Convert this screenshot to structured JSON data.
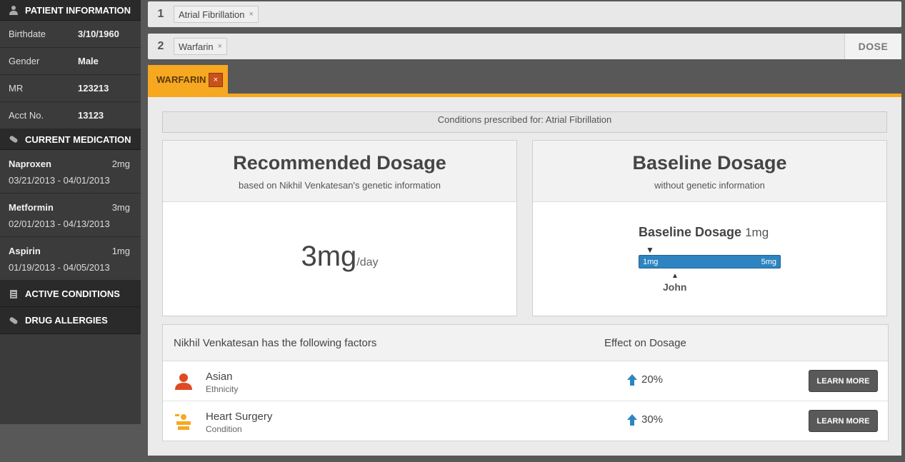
{
  "patient": {
    "header": "PATIENT INFORMATION",
    "fields": [
      {
        "label": "Birthdate",
        "value": "3/10/1960"
      },
      {
        "label": "Gender",
        "value": "Male"
      },
      {
        "label": "MR",
        "value": "123213"
      },
      {
        "label": "Acct No.",
        "value": "13123"
      }
    ]
  },
  "medication": {
    "header": "CURRENT MEDICATION",
    "items": [
      {
        "name": "Naproxen",
        "amount": "2mg",
        "dates": "03/21/2013 - 04/01/2013"
      },
      {
        "name": "Metformin",
        "amount": "3mg",
        "dates": "02/01/2013 - 04/13/2013"
      },
      {
        "name": "Aspirin",
        "amount": "1mg",
        "dates": "01/19/2013 - 04/05/2013"
      }
    ]
  },
  "conditions_header": "ACTIVE CONDITIONS",
  "allergies_header": "DRUG ALLERGIES",
  "query": {
    "row1": {
      "num": "1",
      "chip": "Atrial Fibrillation",
      "chip_close": "×"
    },
    "row2": {
      "num": "2",
      "chip": "Warfarin",
      "chip_close": "×"
    },
    "dose_button": "DOSE"
  },
  "tab": {
    "label": "WARFARIN",
    "close": "×"
  },
  "condition_line": "Conditions prescribed for: Atrial Fibrillation",
  "recommended": {
    "title": "Recommended Dosage",
    "subtitle": "based on Nikhil Venkatesan's genetic information",
    "value": "3mg",
    "unit": "/day"
  },
  "baseline": {
    "title": "Baseline Dosage",
    "subtitle": "without genetic information",
    "gauge_title": "Baseline Dosage",
    "gauge_value": "1mg",
    "scale_min": "1mg",
    "scale_max": "5mg",
    "marker_label": "John"
  },
  "factors": {
    "header_left": "Nikhil Venkatesan has the following factors",
    "header_right": "Effect on Dosage",
    "rows": [
      {
        "name": "Asian",
        "type": "Ethnicity",
        "effect": "20%",
        "button": "LEARN MORE",
        "icon": "person-icon"
      },
      {
        "name": "Heart Surgery",
        "type": "Condition",
        "effect": "30%",
        "button": "LEARN MORE",
        "icon": "surgery-icon"
      }
    ]
  },
  "colors": {
    "accent": "#f6a821",
    "bar": "#2d84c0",
    "sidebar": "#3b3b3b"
  }
}
